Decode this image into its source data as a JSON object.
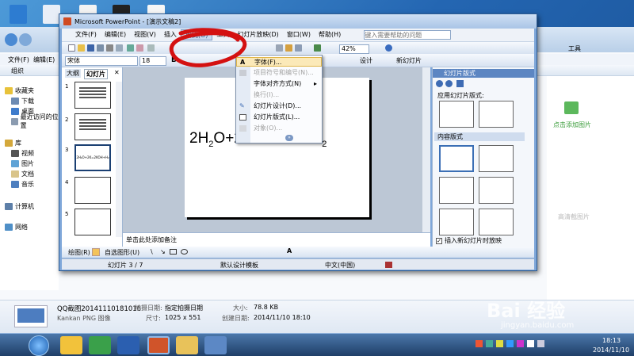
{
  "powerpoint": {
    "title": "Microsoft PowerPoint - [演示文稿2]",
    "menu": [
      "文件(F)",
      "编辑(E)",
      "视图(V)",
      "插入",
      "格式(O)",
      "工具",
      "幻灯片放映(D)",
      "窗口(W)",
      "帮助(H)"
    ],
    "help_placeholder": "键入需要帮助的问题",
    "font_name": "宋体",
    "font_size": "18",
    "zoom": "42%",
    "design_btn": "设计",
    "new_slide_btn": "新幻灯片",
    "panel_tabs": [
      "大纲",
      "幻灯片"
    ],
    "slide_numbers": [
      "1",
      "2",
      "3",
      "4",
      "5"
    ],
    "slide_equation": {
      "prefix": "2H",
      "sub1": "2",
      "middle": "O+2K=2KOH+H",
      "sub2": "2"
    },
    "thumb3_text": "2H₂O+2K=2KOH+H₂",
    "notes_placeholder": "单击此处添加备注",
    "task_pane": {
      "title": "幻灯片版式",
      "apply_label": "应用幻灯片版式:",
      "section_label": "内容版式",
      "checkbox_label": "插入新幻灯片时放映"
    },
    "drawbar": {
      "draw_label": "绘图(R)",
      "autoshape_label": "自选图形(U)"
    },
    "status": {
      "slide_indicator": "幻灯片 3 / 7",
      "template": "默认设计模板",
      "language": "中文(中国)"
    },
    "format_menu": [
      {
        "label": "字体(F)...",
        "icon": "A",
        "disabled": false,
        "highlighted": true
      },
      {
        "label": "项目符号和编号(N)...",
        "icon": "",
        "disabled": true,
        "highlighted": false
      },
      {
        "label": "字体对齐方式(N)",
        "icon": "",
        "disabled": false,
        "highlighted": false,
        "submenu": true
      },
      {
        "label": "换行(I)...",
        "icon": "",
        "disabled": true,
        "highlighted": false
      },
      {
        "label": "幻灯片设计(D)...",
        "icon": "",
        "disabled": false,
        "highlighted": false
      },
      {
        "label": "幻灯片版式(L)...",
        "icon": "",
        "disabled": false,
        "highlighted": false
      },
      {
        "label": "对象(O)...",
        "icon": "",
        "disabled": true,
        "highlighted": false
      }
    ]
  },
  "explorer": {
    "menu": [
      "文件(F)",
      "编辑(E)"
    ],
    "organize": "组织",
    "right_menu": [
      "工具"
    ],
    "nav": [
      "收藏夹",
      "下载",
      "桌面",
      "最近访问的位置",
      "库",
      "视频",
      "图片",
      "文档",
      "音乐",
      "计算机",
      "网络"
    ],
    "right_panel_link": "点击添加图片",
    "right_panel_note": "高清截图片",
    "details": {
      "filename": "QQ截图20141110181016",
      "type": "Kankan PNG 图像",
      "taken_label": "拍摄日期:",
      "taken_value": "指定拍摄日期",
      "dims_label": "尺寸:",
      "dims_value": "1025 x 551",
      "size_label": "大小:",
      "size_value": "78.8 KB",
      "created_label": "创建日期:",
      "created_value": "2014/11/10 18:10"
    }
  },
  "taskbar": {
    "time": "18:13",
    "date": "2014/11/10"
  },
  "watermark": {
    "brand": "Bai 经验",
    "url": "jingyan.baidu.com"
  }
}
